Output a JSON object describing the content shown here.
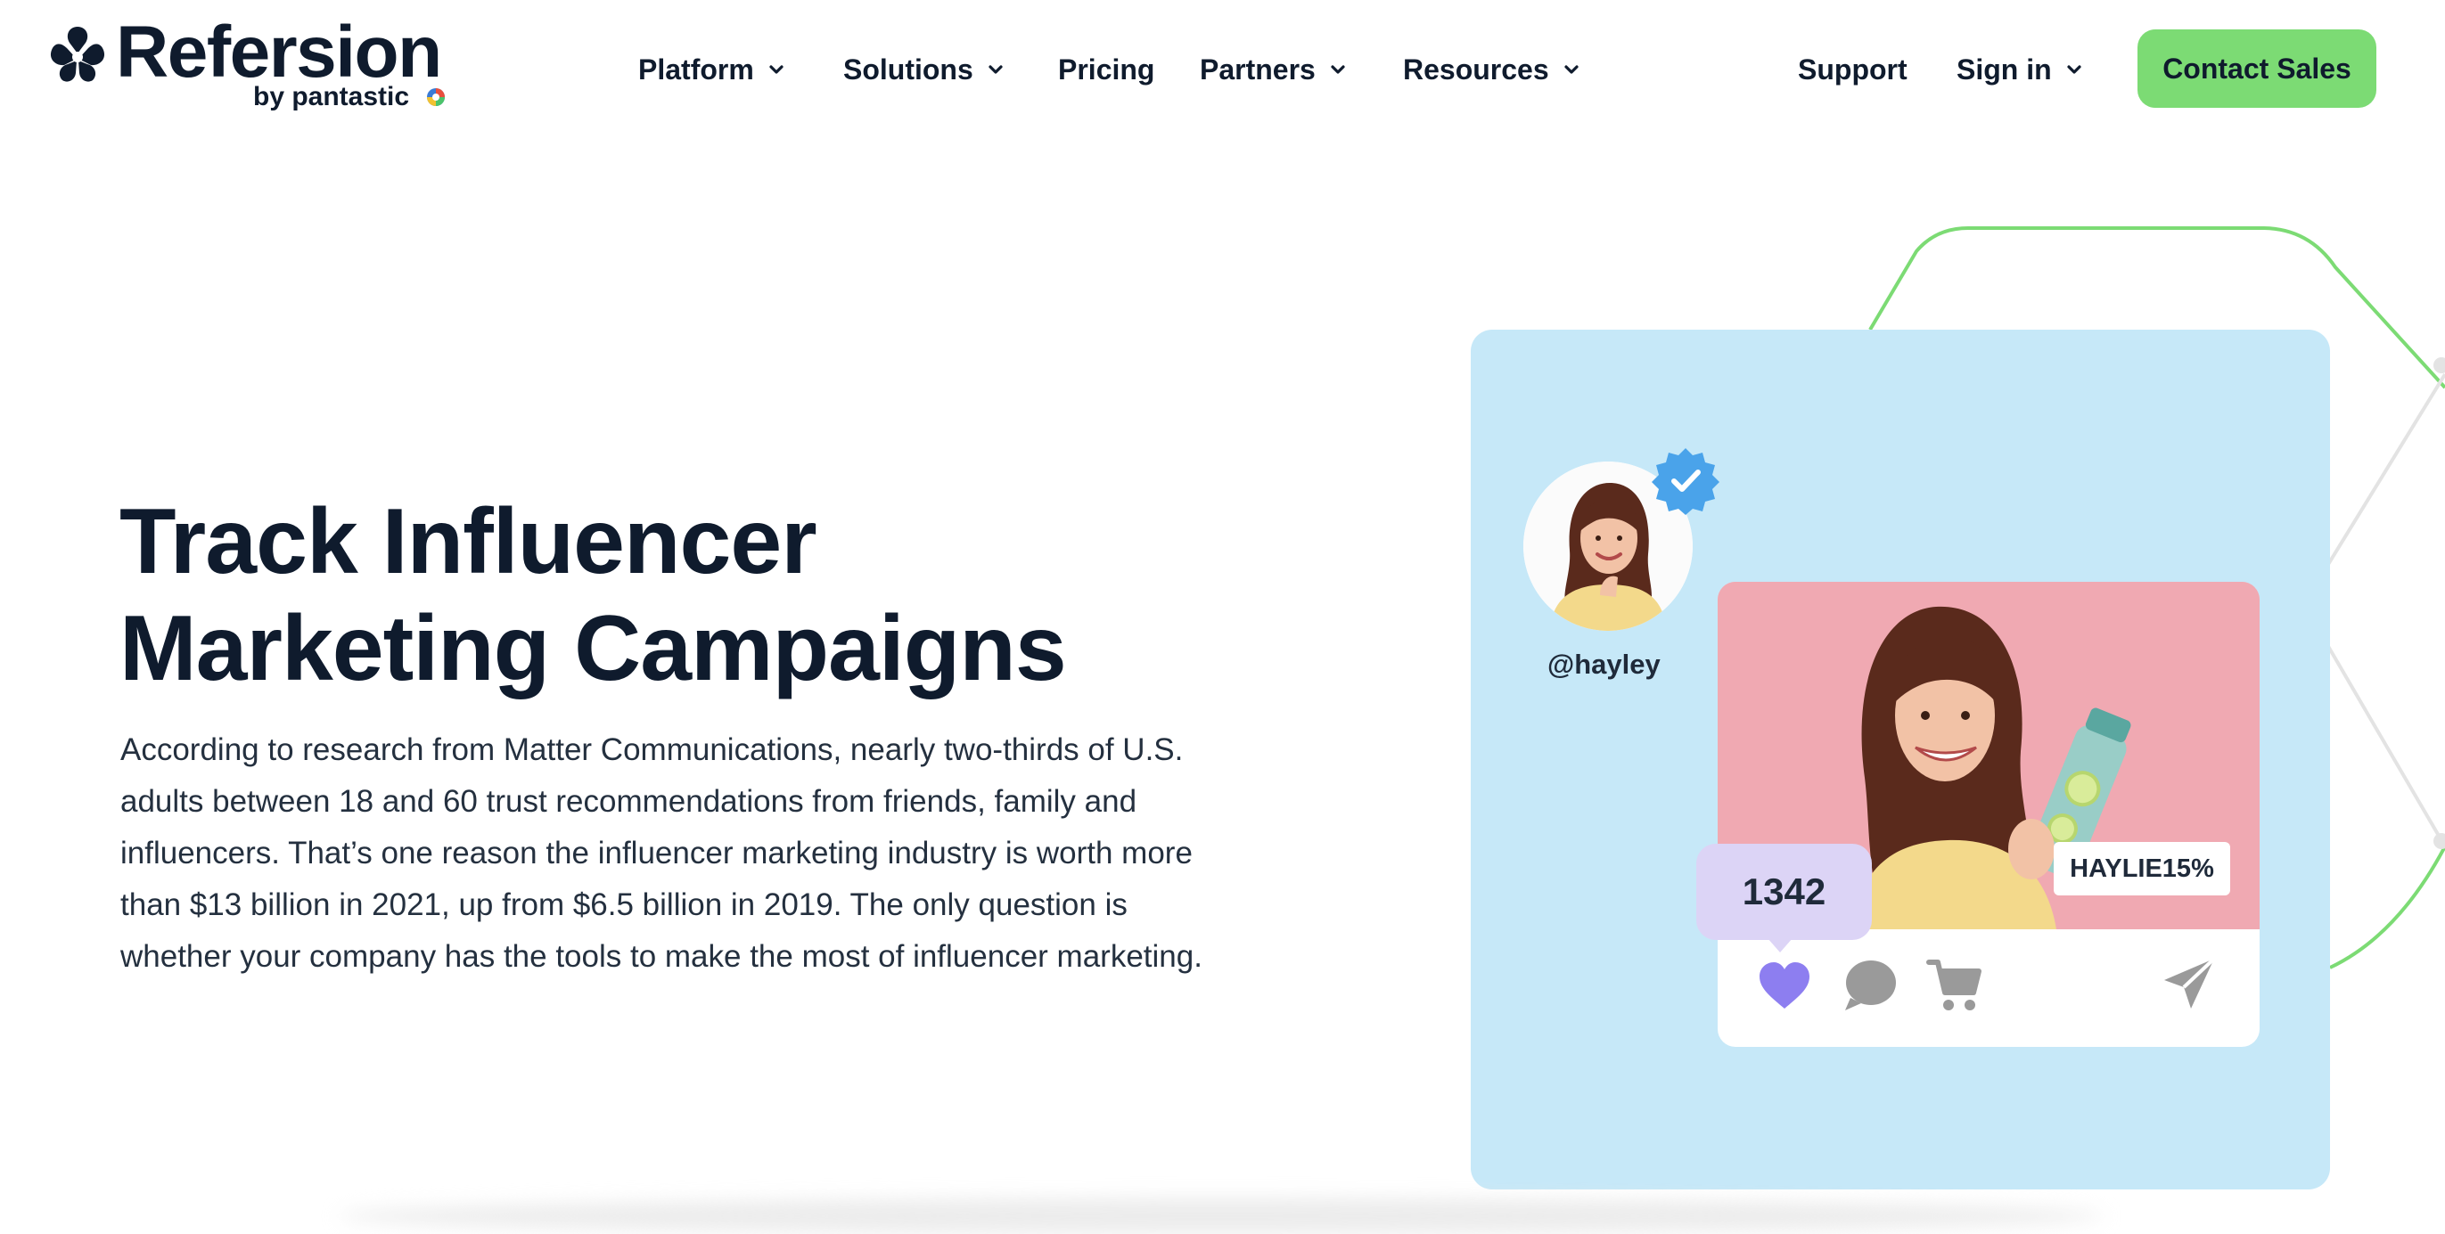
{
  "brand": {
    "name": "Refersion",
    "tagline": "by pantastic",
    "accent": "#7cdb74",
    "text": "#0f1b2d"
  },
  "nav": {
    "platform": "Platform",
    "solutions": "Solutions",
    "pricing": "Pricing",
    "partners": "Partners",
    "resources": "Resources",
    "support": "Support",
    "sign_in": "Sign in",
    "contact_sales": "Contact Sales"
  },
  "hero": {
    "headline_line1": "Track Influencer",
    "headline_line2": "Marketing Campaigns",
    "body": "According to research from Matter Communications, nearly two-thirds of U.S. adults between 18 and 60 trust recommendations from friends, family and influencers. That’s one reason the influencer marketing industry is worth more than $13 billion in 2021, up from $6.5 billion in 2019. The only question is whether your company has the tools to make the most of influencer marketing."
  },
  "illustration": {
    "handle": "@hayley",
    "likes": "1342",
    "coupon_code": "HAYLIE15%",
    "card_color": "#c6e8f8",
    "photo_bg": "#f0a9b2",
    "likes_bubble_color": "#dcd4f6",
    "heart_color": "#8d7ef0",
    "icons": [
      "verified-badge-icon",
      "heart-icon",
      "comment-icon",
      "cart-icon",
      "send-icon"
    ]
  }
}
